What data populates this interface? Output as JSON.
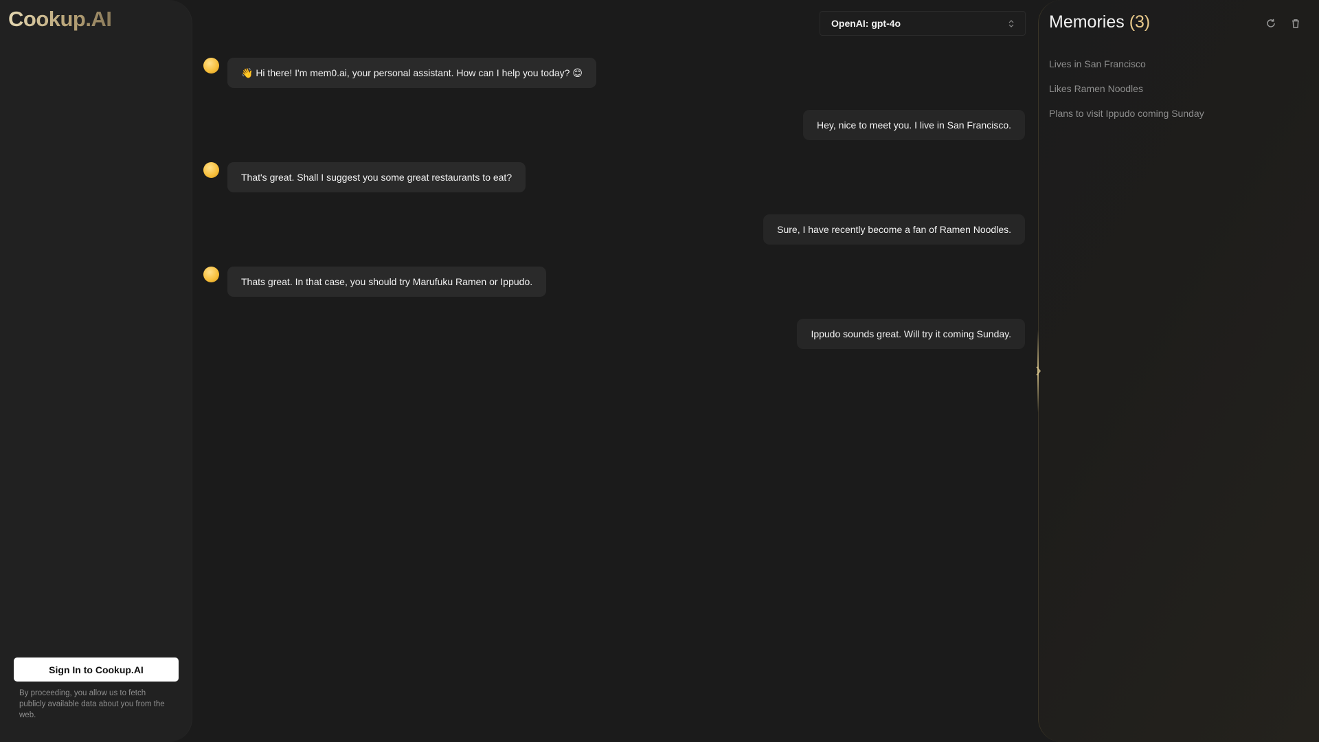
{
  "brand": {
    "logo": "Cookup.AI"
  },
  "sidebar": {
    "signin_label": "Sign In to Cookup.AI",
    "disclaimer": "By proceeding, you allow us to fetch publicly available data about you from the web."
  },
  "model_select": {
    "value": "OpenAI: gpt-4o"
  },
  "chat": {
    "messages": [
      {
        "role": "assistant",
        "text": "👋 Hi there! I'm mem0.ai, your personal assistant. How can I help you today? 😊"
      },
      {
        "role": "user",
        "text": "Hey, nice to meet you. I live in San Francisco."
      },
      {
        "role": "assistant",
        "text": "That's great. Shall I suggest you some great restaurants to eat?"
      },
      {
        "role": "user",
        "text": "Sure, I have recently become a fan of Ramen Noodles."
      },
      {
        "role": "assistant",
        "text": "Thats great. In that case, you should try Marufuku Ramen or Ippudo."
      },
      {
        "role": "user",
        "text": "Ippudo sounds great. Will try it coming Sunday."
      }
    ]
  },
  "memories": {
    "title": "Memories",
    "count": "(3)",
    "items": [
      "Lives in San Francisco",
      "Likes Ramen Noodles",
      "Plans to visit Ippudo coming Sunday"
    ],
    "icons": {
      "refresh": "refresh-icon",
      "delete": "trash-icon"
    }
  },
  "colors": {
    "accent": "#e9c98a",
    "avatar": "#f6bd39",
    "background": "#1b1b1b"
  }
}
